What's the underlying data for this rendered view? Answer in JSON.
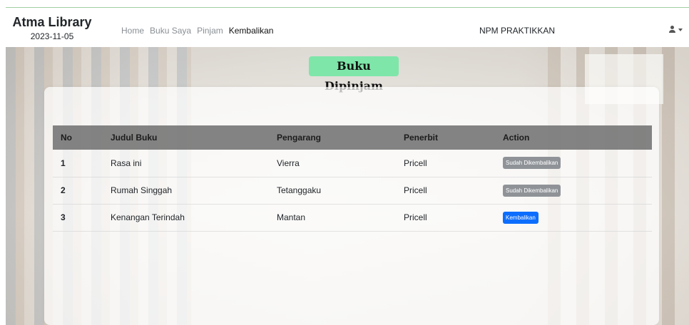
{
  "brand": {
    "name": "Atma Library",
    "date": "2023-11-05"
  },
  "nav": {
    "links": [
      "Home",
      "Buku Saya",
      "Pinjam",
      "Kembalikan"
    ],
    "active": "Kembalikan"
  },
  "npm_label": "NPM PRAKTIKKAN",
  "page": {
    "heading": "Buku Dipinjam",
    "accent_color": "#7ee6a9"
  },
  "table": {
    "headers": [
      "No",
      "Judul Buku",
      "Pengarang",
      "Penerbit",
      "Action"
    ],
    "rows": [
      {
        "no": "1",
        "judul": "Rasa ini",
        "pengarang": "Vierra",
        "penerbit": "Pricell",
        "action": "Sudah Dikembalikan",
        "action_state": "disabled"
      },
      {
        "no": "2",
        "judul": "Rumah Singgah",
        "pengarang": "Tetanggaku",
        "penerbit": "Pricell",
        "action": "Sudah Dikembalikan",
        "action_state": "disabled"
      },
      {
        "no": "3",
        "judul": "Kenangan Terindah",
        "pengarang": "Mantan",
        "penerbit": "Pricell",
        "action": "Kembalikan",
        "action_state": "primary"
      }
    ]
  },
  "colors": {
    "primary_button": "#0d6efd",
    "disabled_button": "#8f9398",
    "header_bar": "#6e6e6e"
  }
}
